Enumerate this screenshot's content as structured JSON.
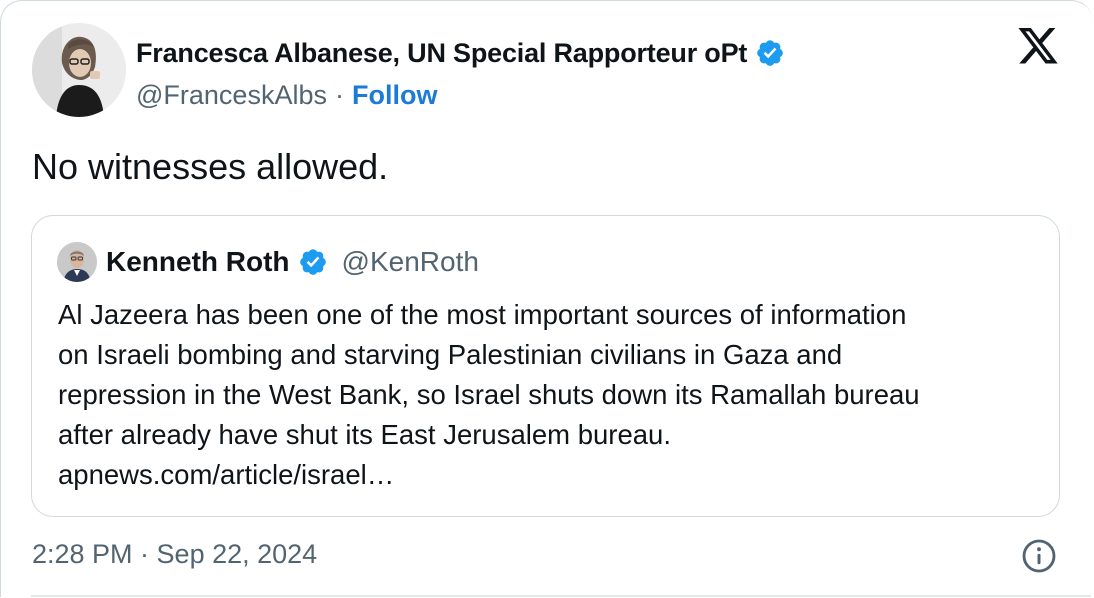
{
  "tweet": {
    "author": {
      "name": "Francesca Albanese, UN Special Rapporteur oPt",
      "handle": "@FranceskAlbs",
      "separator": "·",
      "follow_label": "Follow",
      "avatar_icon": "profile-photo",
      "verified_icon": "verified-badge-icon"
    },
    "text": "No witnesses allowed.",
    "quote": {
      "author_name": "Kenneth Roth",
      "author_handle": "@KenRoth",
      "lines": [
        "Al Jazeera has been one of the most important sources of information",
        "on Israeli bombing and starving Palestinian civilians in Gaza and",
        "repression in the West Bank, so Israel shuts down its Ramallah bureau",
        "after already have shut its East Jerusalem bureau.",
        "apnews.com/article/israel…"
      ]
    },
    "timestamp": "2:28 PM · Sep 22, 2024",
    "platform_icon": "x-logo-icon",
    "info_icon": "info-icon",
    "colors": {
      "verified": "#1d9bf0",
      "follow": "#1d7bd8",
      "secondary_text": "#536471",
      "border": "#cfd9de"
    }
  }
}
